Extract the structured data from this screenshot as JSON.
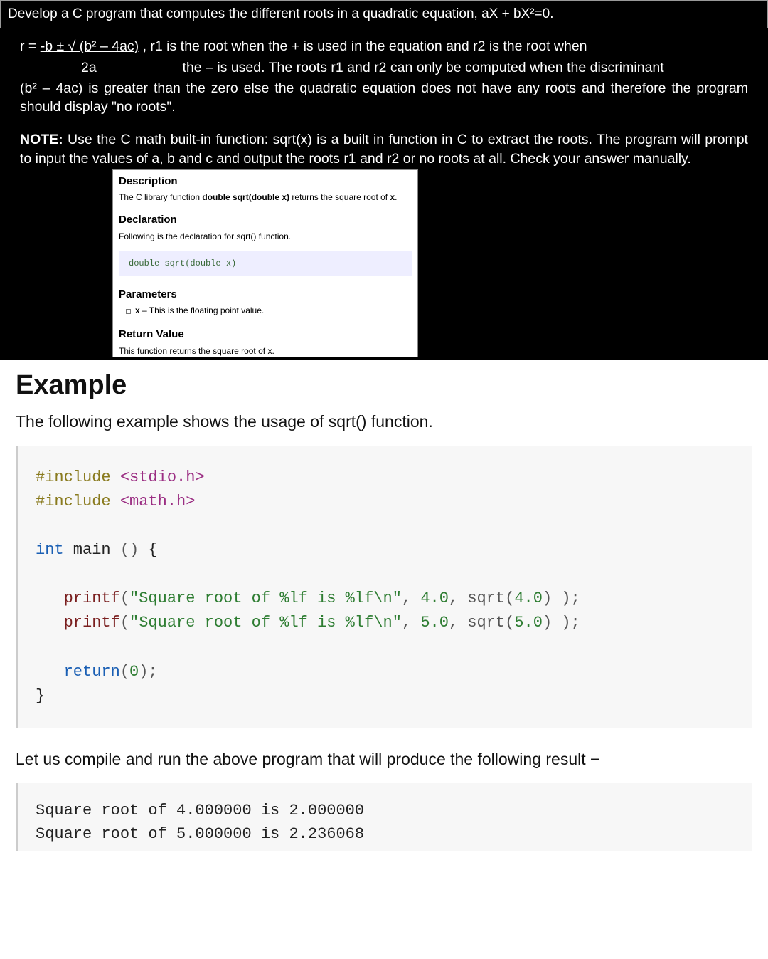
{
  "header": {
    "title": "Develop a C program that computes the different roots in a quadratic equation, aX + bX²=0."
  },
  "body": {
    "formula_lhs": "r = ",
    "formula_top": "-b ± √ (b² – 4ac)",
    "formula_after": " , r1 is the root when the + is used in the equation and r2 is the root when",
    "denom": "2a",
    "denom_after": "the – is used. The roots r1 and r2 can only be computed when the discriminant",
    "para2": "(b² – 4ac) is greater than the zero else the quadratic equation does not have any roots and therefore the program should display \"no roots\".",
    "note_label": "NOTE:",
    "note_text_before": " Use the C math built-in function: sqrt(x) is a ",
    "note_builtin": "built in",
    "note_text_after": " function in C to extract the roots. The program will prompt to input the values of a, b and c and output the roots r1 and r2 or no roots at all. Check your answer ",
    "note_manually": "manually."
  },
  "doc": {
    "desc_h": "Description",
    "desc_t_pre": "The C library function ",
    "desc_t_bold": "double sqrt(double x)",
    "desc_t_post": " returns the square root of ",
    "desc_t_x": "x",
    "desc_t_dot": ".",
    "decl_h": "Declaration",
    "decl_t": "Following is the declaration for sqrt() function.",
    "decl_code": "double sqrt(double x)",
    "param_h": "Parameters",
    "param_x": "x",
    "param_t": " – This is the floating point value.",
    "ret_h": "Return Value",
    "ret_t": "This function returns the square root of x."
  },
  "example": {
    "h1": "Example",
    "intro": "The following example shows the usage of sqrt() function.",
    "result_intro": "Let us compile and run the above program that will produce the following result −"
  },
  "code": {
    "l1_a": "#include",
    "l1_b": " <stdio.h>",
    "l2_a": "#include",
    "l2_b": " <math.h>",
    "l4_a": "int",
    "l4_b": " main ",
    "l4_c": "()",
    "l4_d": " {",
    "l6_a": "   printf",
    "l6_b": "(",
    "l6_c": "\"Square root of %lf is %lf\\n\"",
    "l6_d": ", ",
    "l6_e": "4.0",
    "l6_f": ", sqrt(",
    "l6_g": "4.0",
    "l6_h": ") );",
    "l7_a": "   printf",
    "l7_b": "(",
    "l7_c": "\"Square root of %lf is %lf\\n\"",
    "l7_d": ", ",
    "l7_e": "5.0",
    "l7_f": ", sqrt(",
    "l7_g": "5.0",
    "l7_h": ") );",
    "l9_a": "   return",
    "l9_b": "(",
    "l9_c": "0",
    "l9_d": ");",
    "l10": "}"
  },
  "output": {
    "l1": "Square root of 4.000000 is 2.000000",
    "l2": "Square root of 5.000000 is 2.236068"
  }
}
